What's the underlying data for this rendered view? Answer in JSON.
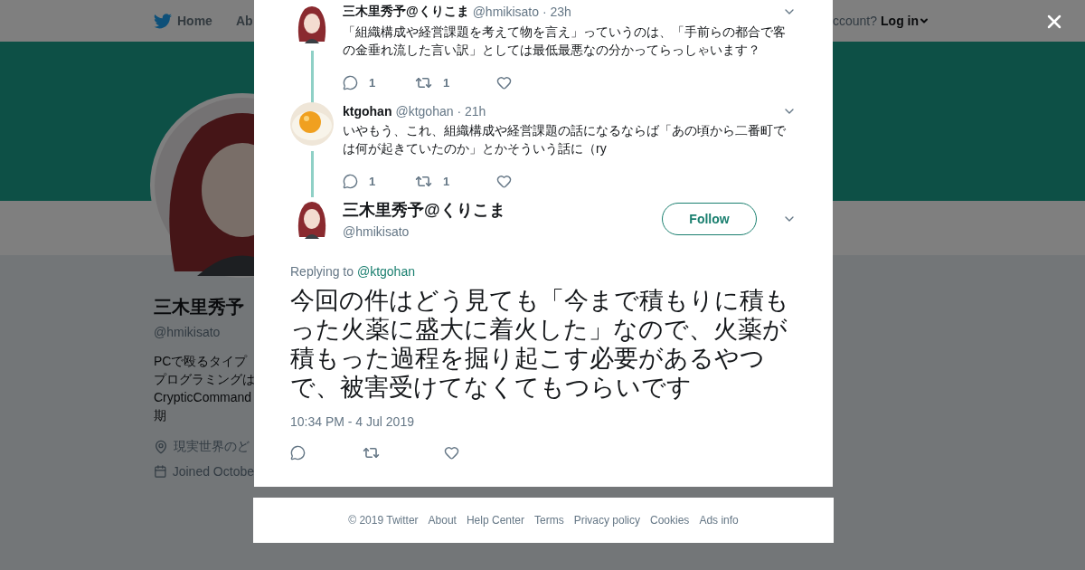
{
  "nav": {
    "home": "Home",
    "about": "Ab",
    "login_prompt": "ccount?",
    "login": "Log in"
  },
  "profile": {
    "name": "三木里秀予",
    "handle": "@hmikisato",
    "bio": [
      "PCで殴るタイプ",
      "プログラミングは",
      "CrypticCommand",
      "期"
    ],
    "location": "現実世界のど",
    "joined": "Joined Octobe"
  },
  "thread": [
    {
      "avatar": {
        "kind": "character"
      },
      "name": "三木里秀予@くりこま",
      "handle": "@hmikisato",
      "time": "· 23h",
      "text": "「組織構成や経営課題を考えて物を言え」っていうのは、「手前らの都合で客の金垂れ流した言い訳」としては最低最悪なの分かってらっしゃいます？",
      "replies": "1",
      "retweets": "1"
    },
    {
      "name": "ktgohan",
      "handle": "@ktgohan",
      "time": "· 21h",
      "text": "いやもう、これ、組織構成や経営課題の話になるならば「あの頃から二番町では何が起きていたのか」とかそういう話に（ry",
      "replies": "1",
      "retweets": "1"
    }
  ],
  "main_tweet": {
    "avatar": {
      "kind": "character"
    },
    "name": "三木里秀予@くりこま",
    "handle": "@hmikisato",
    "follow": "Follow",
    "replying_label": "Replying to",
    "replying_to": "@ktgohan",
    "text": "今回の件はどう見ても「今まで積もりに積もった火薬に盛大に着火した」なので、火薬が積もった過程を掘り起こす必要があるやつで、被害受けてなくてもつらいです",
    "time": "10:34 PM - 4 Jul 2019"
  },
  "footer": [
    "© 2019 Twitter",
    "About",
    "Help Center",
    "Terms",
    "Privacy policy",
    "Cookies",
    "Ads info"
  ]
}
